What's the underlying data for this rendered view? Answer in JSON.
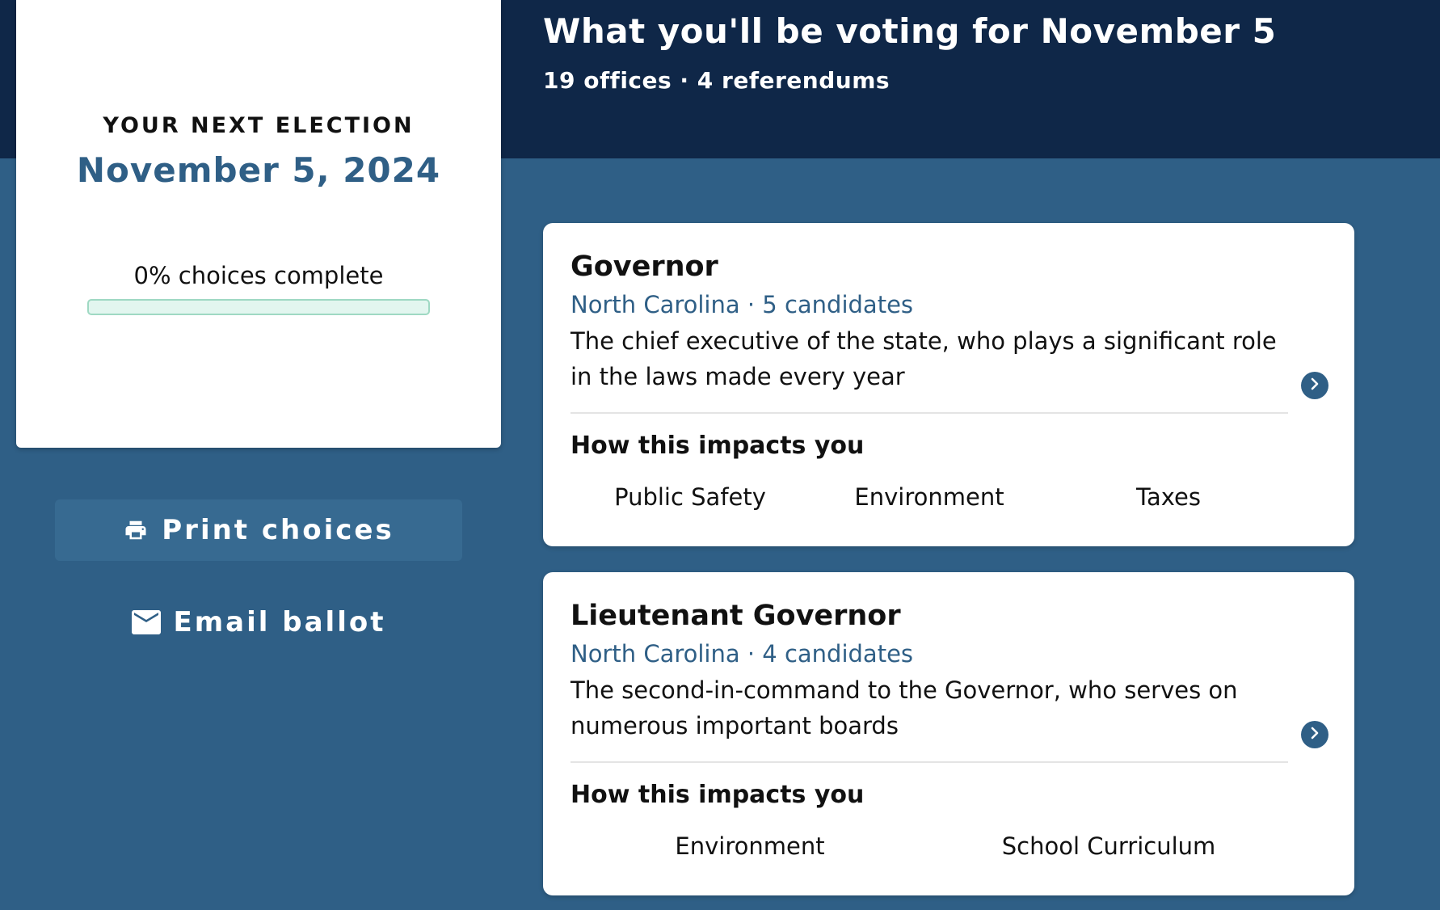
{
  "header": {
    "title": "What you'll be voting for November 5",
    "subtitle": "19 offices · 4 referendums"
  },
  "election": {
    "label": "YOUR NEXT ELECTION",
    "date": "November 5, 2024",
    "progress_label": "0% choices complete",
    "progress_percent": 0
  },
  "actions": {
    "print_label": "Print choices",
    "print_icon": "printer-icon",
    "email_label": "Email ballot",
    "email_icon": "envelope-icon"
  },
  "offices": [
    {
      "title": "Governor",
      "meta": "North Carolina · 5 candidates",
      "description": "The chief executive of the state, who plays a significant role in the laws made every year",
      "impact_heading": "How this impacts you",
      "tags": [
        "Public Safety",
        "Environment",
        "Taxes"
      ]
    },
    {
      "title": "Lieutenant Governor",
      "meta": "North Carolina · 4 candidates",
      "description": "The second-in-command to the Governor, who serves on numerous important boards",
      "impact_heading": "How this impacts you",
      "tags": [
        "Environment",
        "School Curriculum"
      ]
    }
  ],
  "colors": {
    "page_background": "#2f5f86",
    "header_band": "#0f2748",
    "accent": "#2f5f86",
    "progress_track": "#e2f6ef"
  }
}
